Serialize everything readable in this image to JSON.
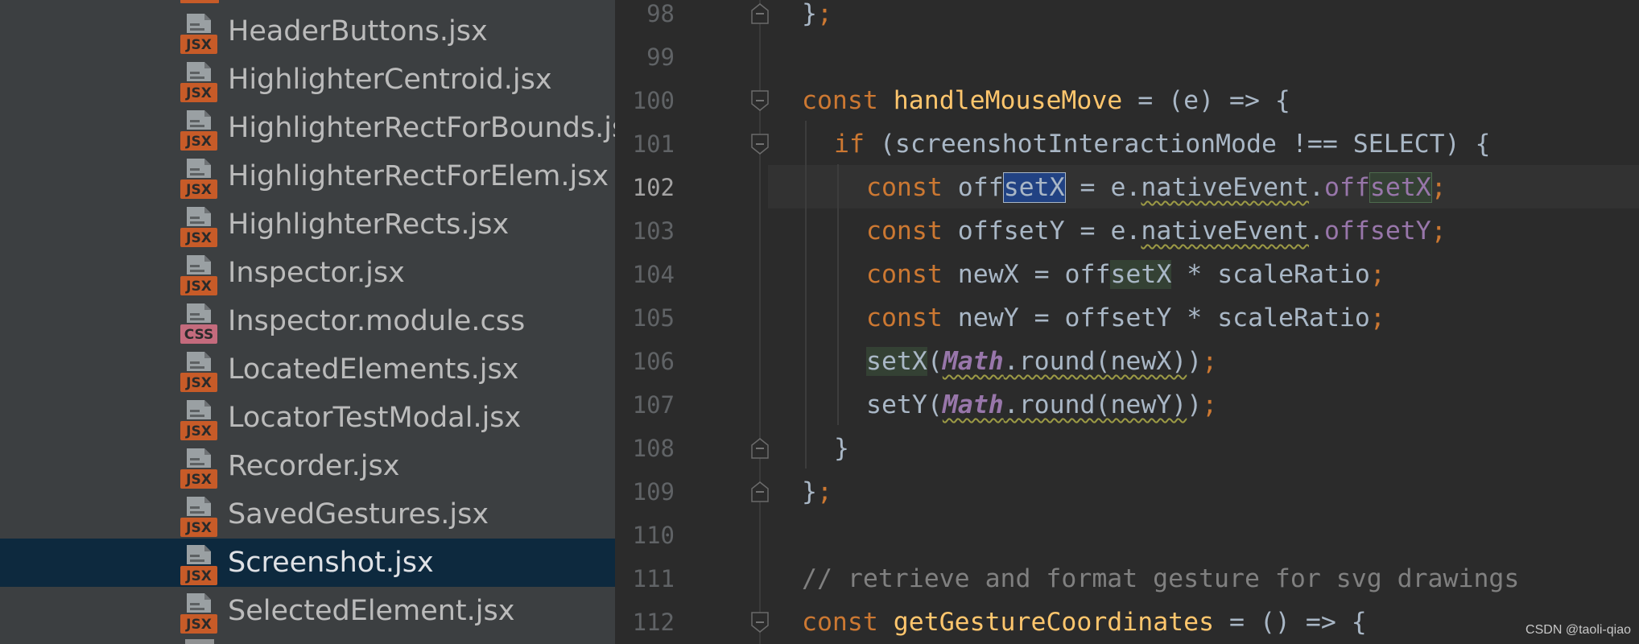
{
  "project_tree": {
    "items": [
      {
        "name": "HeaderButtons.jsx",
        "type": "JSX"
      },
      {
        "name": "HighlighterCentroid.jsx",
        "type": "JSX"
      },
      {
        "name": "HighlighterRectForBounds.jsx",
        "type": "JSX"
      },
      {
        "name": "HighlighterRectForElem.jsx",
        "type": "JSX"
      },
      {
        "name": "HighlighterRects.jsx",
        "type": "JSX"
      },
      {
        "name": "Inspector.jsx",
        "type": "JSX"
      },
      {
        "name": "Inspector.module.css",
        "type": "CSS"
      },
      {
        "name": "LocatedElements.jsx",
        "type": "JSX"
      },
      {
        "name": "LocatorTestModal.jsx",
        "type": "JSX"
      },
      {
        "name": "Recorder.jsx",
        "type": "JSX"
      },
      {
        "name": "SavedGestures.jsx",
        "type": "JSX"
      },
      {
        "name": "Screenshot.jsx",
        "type": "JSX",
        "selected": true
      },
      {
        "name": "SelectedElement.jsx",
        "type": "JSX"
      }
    ]
  },
  "editor": {
    "current_line": 102,
    "lines": [
      {
        "number": "98",
        "indent": 0,
        "fold": "end",
        "tokens": [
          {
            "text": "}",
            "cls": "default"
          },
          {
            "text": ";",
            "cls": "kw"
          }
        ]
      },
      {
        "number": "99",
        "indent": 0,
        "tokens": []
      },
      {
        "number": "100",
        "indent": 0,
        "fold": "start",
        "tokens": [
          {
            "text": "const ",
            "cls": "kw"
          },
          {
            "text": "handleMouseMove",
            "cls": "fn"
          },
          {
            "text": " = (e) => {",
            "cls": "default"
          }
        ]
      },
      {
        "number": "101",
        "indent": 1,
        "fold": "start",
        "tokens": [
          {
            "text": "if ",
            "cls": "kw"
          },
          {
            "text": "(screenshotInteractionMode !== SELECT) {",
            "cls": "default"
          }
        ]
      },
      {
        "number": "102",
        "indent": 2,
        "tokens": [
          {
            "text": "const ",
            "cls": "kw"
          },
          {
            "text": "off",
            "cls": "default"
          },
          {
            "text": "setX",
            "cls": "default",
            "hl": "caret"
          },
          {
            "text": " = e.",
            "cls": "default"
          },
          {
            "text": "nativeEvent",
            "cls": "default",
            "warn": true
          },
          {
            "text": ".",
            "cls": "default"
          },
          {
            "text": "off",
            "cls": "field"
          },
          {
            "text": "setX",
            "cls": "field",
            "hl": "write-outlined"
          },
          {
            "text": ";",
            "cls": "kw"
          }
        ]
      },
      {
        "number": "103",
        "indent": 2,
        "tokens": [
          {
            "text": "const ",
            "cls": "kw"
          },
          {
            "text": "offsetY = e.",
            "cls": "default"
          },
          {
            "text": "nativeEvent",
            "cls": "default",
            "warn": true
          },
          {
            "text": ".",
            "cls": "default"
          },
          {
            "text": "offsetY",
            "cls": "field"
          },
          {
            "text": ";",
            "cls": "kw"
          }
        ]
      },
      {
        "number": "104",
        "indent": 2,
        "tokens": [
          {
            "text": "const ",
            "cls": "kw"
          },
          {
            "text": "newX = off",
            "cls": "default"
          },
          {
            "text": "setX",
            "cls": "default",
            "hl": "write"
          },
          {
            "text": " * scaleRatio",
            "cls": "default"
          },
          {
            "text": ";",
            "cls": "kw"
          }
        ]
      },
      {
        "number": "105",
        "indent": 2,
        "tokens": [
          {
            "text": "const ",
            "cls": "kw"
          },
          {
            "text": "newY = offsetY * scaleRatio",
            "cls": "default"
          },
          {
            "text": ";",
            "cls": "kw"
          }
        ]
      },
      {
        "number": "106",
        "indent": 2,
        "tokens": [
          {
            "text": "setX",
            "cls": "default",
            "hl": "write"
          },
          {
            "text": "(",
            "cls": "default"
          },
          {
            "text": "Math",
            "cls": "italic",
            "warn": true
          },
          {
            "text": ".round(newX)",
            "cls": "default",
            "warn": true
          },
          {
            "text": ")",
            "cls": "default"
          },
          {
            "text": ";",
            "cls": "kw"
          }
        ]
      },
      {
        "number": "107",
        "indent": 2,
        "tokens": [
          {
            "text": "setY(",
            "cls": "default"
          },
          {
            "text": "Math",
            "cls": "italic",
            "warn": true
          },
          {
            "text": ".round(newY)",
            "cls": "default",
            "warn": true
          },
          {
            "text": ")",
            "cls": "default"
          },
          {
            "text": ";",
            "cls": "kw"
          }
        ]
      },
      {
        "number": "108",
        "indent": 1,
        "fold": "end",
        "tokens": [
          {
            "text": "}",
            "cls": "default"
          }
        ]
      },
      {
        "number": "109",
        "indent": 0,
        "fold": "end",
        "tokens": [
          {
            "text": "}",
            "cls": "default"
          },
          {
            "text": ";",
            "cls": "kw"
          }
        ]
      },
      {
        "number": "110",
        "indent": 0,
        "tokens": []
      },
      {
        "number": "111",
        "indent": 0,
        "tokens": [
          {
            "text": "// retrieve and format gesture for svg drawings",
            "cls": "comment"
          }
        ]
      },
      {
        "number": "112",
        "indent": 0,
        "fold": "start",
        "tokens": [
          {
            "text": "const ",
            "cls": "kw"
          },
          {
            "text": "getGestureCoordinates",
            "cls": "fn"
          },
          {
            "text": " = () => {",
            "cls": "default"
          }
        ]
      }
    ]
  },
  "watermark": "CSDN @taoli-qiao",
  "colors": {
    "tree_bg": "#3c3f41",
    "tree_selected": "#0d293e",
    "editor_bg": "#2b2b2b",
    "keyword": "#cc7832",
    "function": "#ffc66d",
    "field": "#9876aa",
    "comment": "#808080",
    "jsx_badge": "#c75b28",
    "css_badge": "#c46b7d"
  }
}
